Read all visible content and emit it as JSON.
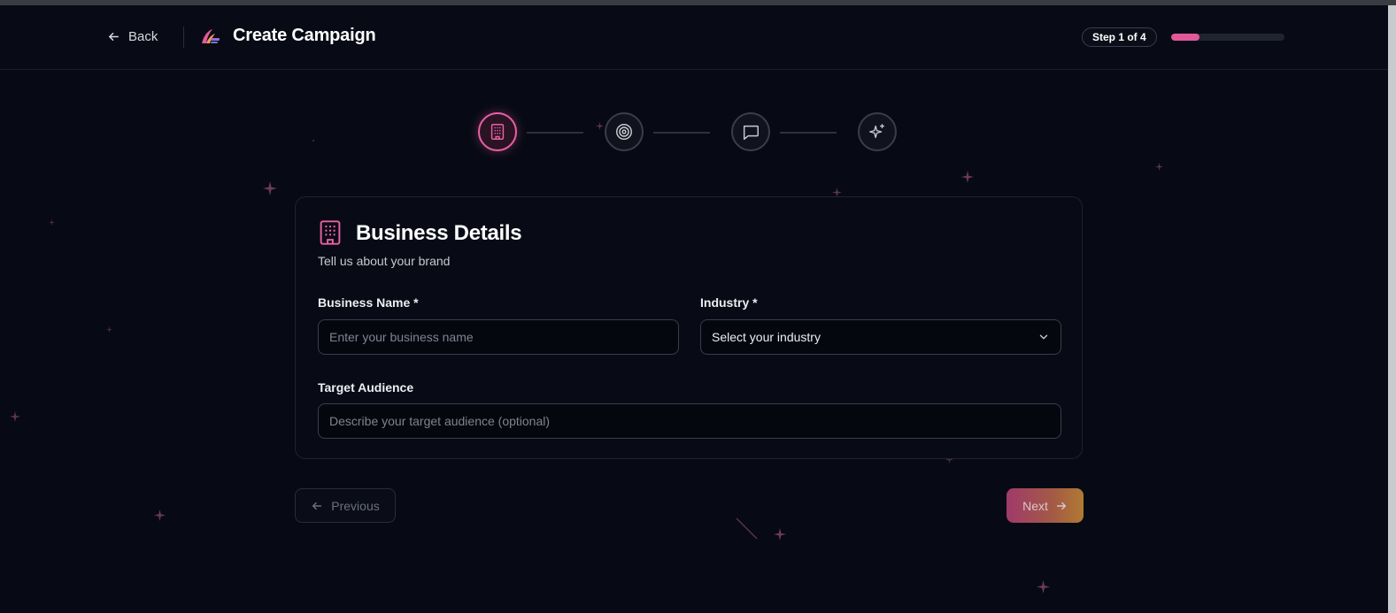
{
  "header": {
    "back_label": "Back",
    "title": "Create Campaign",
    "step_badge": "Step 1 of 4",
    "progress_fraction": 0.25
  },
  "stepper": {
    "steps": [
      {
        "icon": "building-icon",
        "active": true
      },
      {
        "icon": "target-icon",
        "active": false
      },
      {
        "icon": "message-icon",
        "active": false
      },
      {
        "icon": "sparkles-icon",
        "active": false
      }
    ]
  },
  "card": {
    "title": "Business Details",
    "subtitle": "Tell us about your brand",
    "business_name": {
      "label": "Business Name *",
      "placeholder": "Enter your business name",
      "value": ""
    },
    "industry": {
      "label": "Industry *",
      "selected": "Select your industry"
    },
    "target_audience": {
      "label": "Target Audience",
      "placeholder": "Describe your target audience (optional)",
      "value": ""
    }
  },
  "footer": {
    "previous_label": "Previous",
    "next_label": "Next"
  },
  "colors": {
    "background": "#070a14",
    "accent": "#ea5fa5",
    "progress": "#e3589b",
    "next_gradient_start": "#a03a6a",
    "next_gradient_end": "#b07a33"
  }
}
